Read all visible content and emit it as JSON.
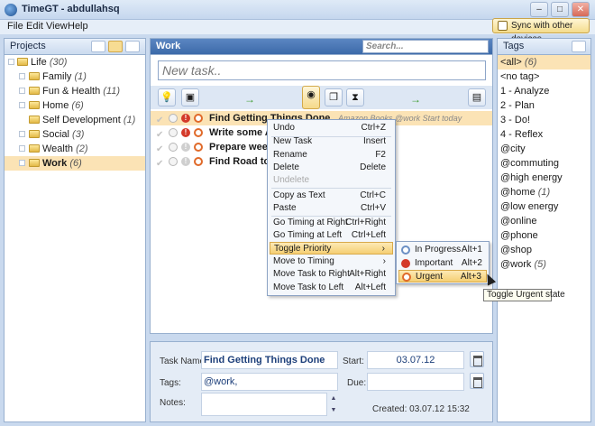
{
  "window": {
    "title": "TimeGT - abdullahsq",
    "buttons": [
      "–",
      "□",
      "✕"
    ]
  },
  "menu": [
    "File",
    "Edit",
    "View",
    "Help"
  ],
  "sync_label": "Sync with other devices",
  "projects": {
    "title": "Projects",
    "items": [
      {
        "name": "Life",
        "count": "(30)"
      },
      {
        "name": "Family",
        "count": "(1)"
      },
      {
        "name": "Fun & Health",
        "count": "(11)"
      },
      {
        "name": "Home",
        "count": "(6)"
      },
      {
        "name": "Self Development",
        "count": "(1)"
      },
      {
        "name": "Social",
        "count": "(3)"
      },
      {
        "name": "Wealth",
        "count": "(2)"
      },
      {
        "name": "Work",
        "count": "(6)"
      }
    ]
  },
  "work": {
    "title": "Work",
    "search_placeholder": "Search...",
    "new_task_placeholder": "New task..",
    "tasks": [
      {
        "name": "Find Getting Things Done",
        "meta": "Amazon Books @work Start today"
      },
      {
        "name": "Write some And",
        "meta": ""
      },
      {
        "name": "Prepare weekly",
        "meta": ""
      },
      {
        "name": "Find Road to Re",
        "meta": ""
      }
    ]
  },
  "details": {
    "task_name_label": "Task Name:",
    "task_name_value": "Find Getting Things Done",
    "tags_label": "Tags:",
    "tags_value": "@work,",
    "notes_label": "Notes:",
    "start_label": "Start:",
    "start_value": "03.07.12",
    "due_label": "Due:",
    "due_value": "",
    "created": "Created: 03.07.12 15:32"
  },
  "tags": {
    "title": "Tags",
    "items": [
      {
        "name": "<all>",
        "count": "(6)"
      },
      {
        "name": "<no tag>",
        "count": ""
      },
      {
        "name": "1 - Analyze",
        "count": ""
      },
      {
        "name": "2 - Plan",
        "count": ""
      },
      {
        "name": "3 - Do!",
        "count": ""
      },
      {
        "name": "4 - Reflex",
        "count": ""
      },
      {
        "name": "@city",
        "count": ""
      },
      {
        "name": "@commuting",
        "count": ""
      },
      {
        "name": "@high energy",
        "count": ""
      },
      {
        "name": "@home",
        "count": "(1)"
      },
      {
        "name": "@low energy",
        "count": ""
      },
      {
        "name": "@online",
        "count": ""
      },
      {
        "name": "@phone",
        "count": ""
      },
      {
        "name": "@shop",
        "count": ""
      },
      {
        "name": "@work",
        "count": "(5)"
      }
    ]
  },
  "context_menu": [
    {
      "label": "Undo",
      "shortcut": "Ctrl+Z"
    },
    {
      "label": "New Task",
      "shortcut": "Insert"
    },
    {
      "label": "Rename",
      "shortcut": "F2"
    },
    {
      "label": "Delete",
      "shortcut": "Delete"
    },
    {
      "label": "Undelete",
      "shortcut": ""
    },
    {
      "label": "Copy as Text",
      "shortcut": "Ctrl+C"
    },
    {
      "label": "Paste",
      "shortcut": "Ctrl+V"
    },
    {
      "label": "Go Timing at Right",
      "shortcut": "Ctrl+Right"
    },
    {
      "label": "Go Timing at Left",
      "shortcut": "Ctrl+Left"
    },
    {
      "label": "Toggle Priority",
      "shortcut": "›"
    },
    {
      "label": "Move to Timing",
      "shortcut": "›"
    },
    {
      "label": "Move Task to Right",
      "shortcut": "Alt+Right"
    },
    {
      "label": "Move Task to Left",
      "shortcut": "Alt+Left"
    }
  ],
  "submenu": [
    {
      "label": "In Progress",
      "shortcut": "Alt+1"
    },
    {
      "label": "Important",
      "shortcut": "Alt+2"
    },
    {
      "label": "Urgent",
      "shortcut": "Alt+3"
    }
  ],
  "tooltip": "Toggle Urgent state"
}
